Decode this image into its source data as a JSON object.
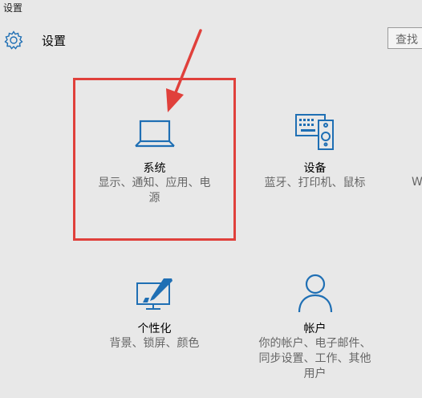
{
  "window": {
    "title": "设置"
  },
  "header": {
    "title": "设置",
    "icon": "gear-icon"
  },
  "search": {
    "text": "查找"
  },
  "accent_color": "#1f6fb4",
  "highlight_color": "#e0403b",
  "tiles": [
    {
      "id": "system",
      "title": "系统",
      "desc_line1": "显示、通知、应用、电",
      "desc_line2": "源",
      "icon": "laptop-icon"
    },
    {
      "id": "devices",
      "title": "设备",
      "desc_line1": "蓝牙、打印机、鼠标",
      "icon": "devices-icon"
    },
    {
      "id": "personalization",
      "title": "个性化",
      "desc_line1": "背景、锁屏、颜色",
      "icon": "personalization-icon"
    },
    {
      "id": "accounts",
      "title": "帐户",
      "desc_line1": "你的帐户、电子邮件、",
      "desc_line2": "同步设置、工作、其他",
      "desc_line3": "用户",
      "icon": "person-icon"
    }
  ],
  "clipped_tile": {
    "desc_fragment": "W"
  }
}
